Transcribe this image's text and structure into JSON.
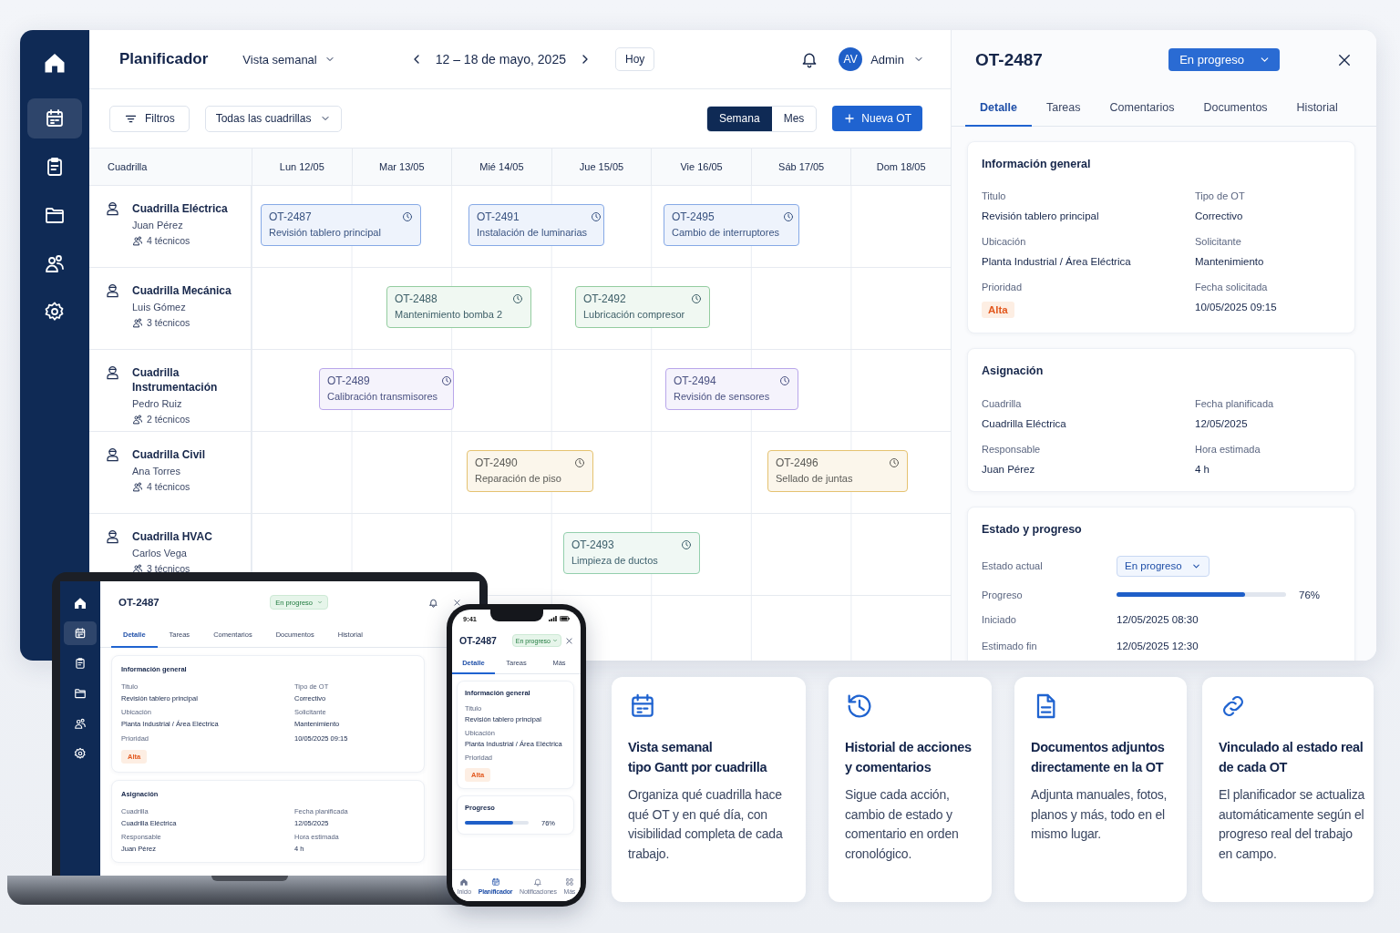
{
  "sidebar": {
    "items": [
      {
        "selected": false
      },
      {
        "selected": true
      },
      {
        "selected": false
      },
      {
        "selected": false
      },
      {
        "selected": false
      },
      {
        "selected": false
      }
    ]
  },
  "planner": {
    "title": "Planificador",
    "view_selector": "Vista semanal",
    "date_range": "12 – 18 de mayo, 2025",
    "today_button": "Hoy",
    "user": {
      "initials": "AV",
      "name": "Admin"
    },
    "filters_button": "Filtros",
    "crew_filter": "Todas las cuadrillas",
    "view_toggle": [
      {
        "label": "Semana",
        "selected": true
      },
      {
        "label": "Mes",
        "selected": false
      }
    ],
    "new_button": "Nueva OT",
    "crew_column": "Cuadrilla",
    "days": [
      "Lun 12/05",
      "Mar 13/05",
      "Mié 14/05",
      "Jue 15/05",
      "Vie 16/05",
      "Sáb 17/05",
      "Dom 18/05"
    ],
    "crews": [
      {
        "name": "Cuadrilla Eléctrica",
        "lead": "Juan Pérez",
        "techs": "4 técnicos",
        "tasks": [
          {
            "code": "OT-2487",
            "title": "Revisión tablero principal",
            "color": "#86a9e6"
          },
          {
            "code": "OT-2491",
            "title": "Instalación de luminarias",
            "color": "#86a9e6"
          },
          {
            "code": "OT-2495",
            "title": "Cambio de interruptores",
            "color": "#86a9e6"
          }
        ]
      },
      {
        "name": "Cuadrilla Mecánica",
        "lead": "Luis Gómez",
        "techs": "3 técnicos",
        "tasks": [
          {
            "code": "OT-2488",
            "title": "Mantenimiento bomba 2",
            "color": "#93cc9f"
          },
          {
            "code": "OT-2492",
            "title": "Lubricación compresor",
            "color": "#93cc9f"
          }
        ]
      },
      {
        "name": "Cuadrilla Instrumentación",
        "lead": "Pedro Ruiz",
        "techs": "2 técnicos",
        "tasks": [
          {
            "code": "OT-2489",
            "title": "Calibración transmisores",
            "color": "#b9a6ea"
          },
          {
            "code": "OT-2494",
            "title": "Revisión de sensores",
            "color": "#b9a6ea"
          }
        ]
      },
      {
        "name": "Cuadrilla Civil",
        "lead": "Ana Torres",
        "techs": "4 técnicos",
        "tasks": [
          {
            "code": "OT-2490",
            "title": "Reparación de piso",
            "color": "#e5c270"
          },
          {
            "code": "OT-2496",
            "title": "Sellado de juntas",
            "color": "#e5c270"
          }
        ]
      },
      {
        "name": "Cuadrilla HVAC",
        "lead": "Carlos Vega",
        "techs": "3 técnicos",
        "tasks": [
          {
            "code": "OT-2493",
            "title": "Limpieza de ductos",
            "color": "#93cfad"
          }
        ]
      }
    ]
  },
  "detail": {
    "code": "OT-2487",
    "status": "En progreso",
    "tabs": [
      {
        "label": "Detalle",
        "selected": true
      },
      {
        "label": "Tareas",
        "selected": false
      },
      {
        "label": "Comentarios",
        "selected": false
      },
      {
        "label": "Documentos",
        "selected": false
      },
      {
        "label": "Historial",
        "selected": false
      }
    ],
    "sections": [
      {
        "title": "Información general",
        "kind": "grid",
        "fields": [
          {
            "label": "Titulo",
            "value": "Revisión tablero principal",
            "kind": "text"
          },
          {
            "label": "Tipo de OT",
            "value": "Correctivo",
            "kind": "text"
          },
          {
            "label": "Ubicación",
            "value": "Planta Industrial / Área Eléctrica",
            "kind": "text"
          },
          {
            "label": "Solicitante",
            "value": "Mantenimiento",
            "kind": "text"
          },
          {
            "label": "Prioridad",
            "value": "Alta",
            "kind": "badge"
          },
          {
            "label": "Fecha solicitada",
            "value": "10/05/2025 09:15",
            "kind": "text"
          }
        ]
      },
      {
        "title": "Asignación",
        "kind": "grid",
        "fields": [
          {
            "label": "Cuadrilla",
            "value": "Cuadrilla Eléctrica",
            "kind": "text"
          },
          {
            "label": "Fecha planificada",
            "value": "12/05/2025",
            "kind": "text"
          },
          {
            "label": "Responsable",
            "value": "Juan Pérez",
            "kind": "text"
          },
          {
            "label": "Hora estimada",
            "value": "4 h",
            "kind": "text"
          }
        ]
      },
      {
        "title": "Estado y progreso",
        "kind": "rows",
        "fields": [
          {
            "label": "Estado actual",
            "value": "En progreso",
            "kind": "dropdown"
          },
          {
            "label": "Progreso",
            "kind": "progress",
            "level": 0.76,
            "value": "76%"
          },
          {
            "label": "Iniciado",
            "value": "12/05/2025 08:30",
            "kind": "text"
          },
          {
            "label": "Estimado fin",
            "value": "12/05/2025 12:30",
            "kind": "text"
          }
        ]
      }
    ]
  },
  "laptop": {
    "sidebar": {
      "items": [
        {
          "selected": false
        },
        {
          "selected": true
        },
        {
          "selected": false
        },
        {
          "selected": false
        },
        {
          "selected": false
        },
        {
          "selected": false
        }
      ]
    },
    "detail": {
      "code": "OT-2487",
      "status": "En progreso",
      "tabs": [
        {
          "label": "Detalle",
          "selected": true
        },
        {
          "label": "Tareas",
          "selected": false
        },
        {
          "label": "Comentarios",
          "selected": false
        },
        {
          "label": "Documentos",
          "selected": false
        },
        {
          "label": "Historial",
          "selected": false
        }
      ],
      "sections": [
        {
          "title": "Información general",
          "kind": "grid",
          "fields": [
            {
              "label": "Titulo",
              "value": "Revisión tablero principal",
              "kind": "text"
            },
            {
              "label": "Tipo de OT",
              "value": "Correctivo",
              "kind": "text"
            },
            {
              "label": "Ubicación",
              "value": "Planta Industrial / Área Eléctrica",
              "kind": "text"
            },
            {
              "label": "Solicitante",
              "value": "Mantenimiento",
              "kind": "text"
            },
            {
              "label": "Prioridad",
              "value": "Alta",
              "kind": "badge"
            },
            {
              "value": "10/05/2025 09:15",
              "kind": "text"
            }
          ]
        },
        {
          "title": "Asignación",
          "kind": "grid",
          "fields": [
            {
              "label": "Cuadrilla",
              "value": "Cuadrilla Eléctrica",
              "kind": "text"
            },
            {
              "label": "Fecha planificada",
              "value": "12/05/2025",
              "kind": "text"
            },
            {
              "label": "Responsable",
              "value": "Juan Pérez",
              "kind": "text"
            },
            {
              "label": "Hora estimada",
              "value": "4 h",
              "kind": "text"
            }
          ]
        }
      ]
    }
  },
  "phone": {
    "time": "9:41",
    "detail": {
      "code": "OT-2487",
      "status": "En progreso",
      "tabs": [
        {
          "label": "Detalle",
          "selected": true
        },
        {
          "label": "Tareas",
          "selected": false
        },
        {
          "label": "Más",
          "selected": false
        }
      ],
      "sections": [
        {
          "title": "Información general",
          "kind": "stack",
          "fields": [
            {
              "label": "Titulo",
              "value": "Revisión tablero principal",
              "kind": "text"
            },
            {
              "label": "Ubicación",
              "value": "Planta Industrial / Área Eléctrica",
              "kind": "text"
            },
            {
              "label": "Prioridad",
              "value": "Alta",
              "kind": "badge"
            }
          ]
        },
        {
          "title": "Progreso",
          "kind": "stack",
          "fields": [
            {
              "kind": "progress",
              "level": 0.76,
              "value": "76%"
            }
          ]
        }
      ]
    },
    "nav": [
      {
        "label": "Inicio",
        "selected": false
      },
      {
        "label": "Planificador",
        "selected": true
      },
      {
        "label": "Notificaciones",
        "selected": false
      },
      {
        "label": "Más",
        "selected": false
      }
    ]
  },
  "features": [
    {
      "title": "Vista semanal\ntipo Gantt por cuadrilla",
      "text": "Organiza qué cuadrilla hace qué OT y en qué día, con visibilidad completa de cada trabajo."
    },
    {
      "title": "Historial de acciones\ny comentarios",
      "text": "Sigue cada acción, cambio de estado y comentario en orden cronológico."
    },
    {
      "title": "Documentos adjuntos\ndirectamente en la OT",
      "text": "Adjunta manuales, fotos, planos y más, todo en el mismo lugar."
    },
    {
      "title": "Vinculado al estado real\nde cada OT",
      "text": "El planificador se actualiza automáticamente según el progreso real del trabajo en campo."
    }
  ]
}
